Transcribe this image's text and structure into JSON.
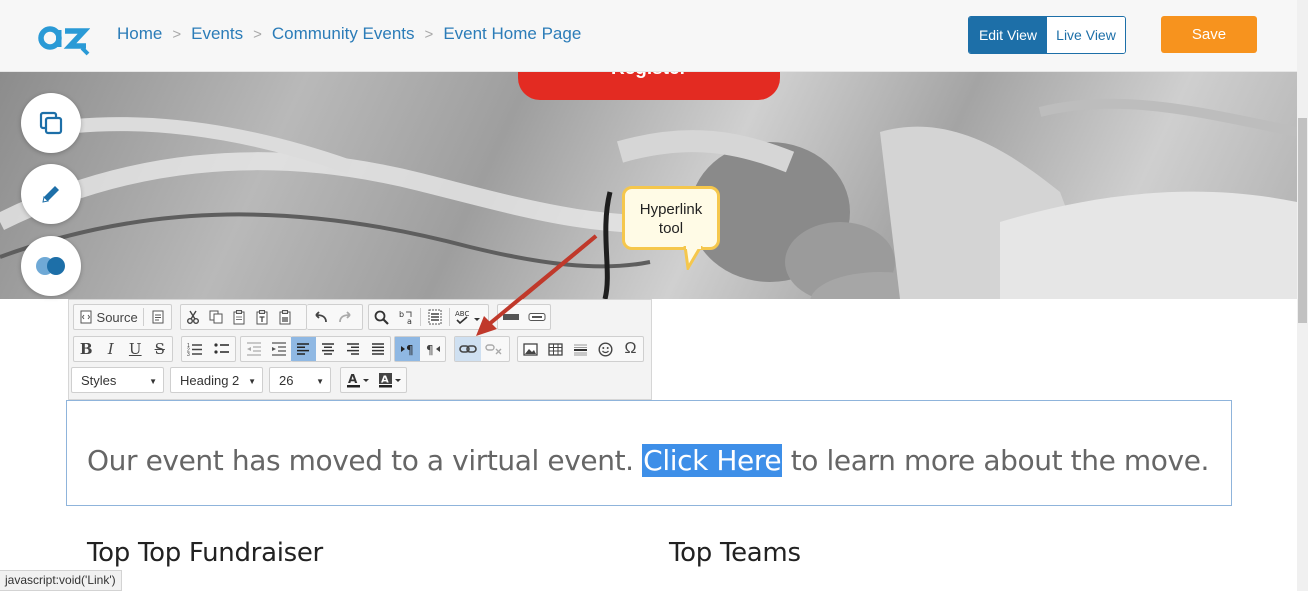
{
  "header": {
    "logo_text": "az",
    "breadcrumbs": [
      "Home",
      "Events",
      "Community Events",
      "Event Home Page"
    ],
    "separator": ">",
    "edit_view_label": "Edit View",
    "live_view_label": "Live View",
    "save_label": "Save"
  },
  "hero": {
    "register_label": "Register"
  },
  "side_tools": [
    {
      "icon": "copy-icon"
    },
    {
      "icon": "pencil-icon"
    },
    {
      "icon": "toggle-icon"
    }
  ],
  "callout": {
    "line1": "Hyperlink",
    "line2": "tool"
  },
  "toolbar": {
    "source_label": "Source",
    "styles_value": "Styles",
    "format_value": "Heading 2",
    "size_value": "26",
    "bold_label": "B",
    "italic_label": "I",
    "underline_label": "U",
    "strike_label": "S",
    "omega_label": "Ω"
  },
  "editor": {
    "text_before": "Our event has moved to a virtual event. ",
    "selected_text": "Click Here",
    "text_after": " to learn more about the move."
  },
  "sections": {
    "left_heading": "Top Top Fundraiser",
    "right_heading": "Top Teams"
  },
  "status_bar": {
    "text": "javascript:void('Link')"
  },
  "colors": {
    "brand_blue": "#1d6fa8",
    "save_orange": "#f7931e",
    "register_red": "#e32b22",
    "selection_blue": "#3e8fe8",
    "callout_border": "#f5c74c",
    "arrow_red": "#c0392b"
  }
}
